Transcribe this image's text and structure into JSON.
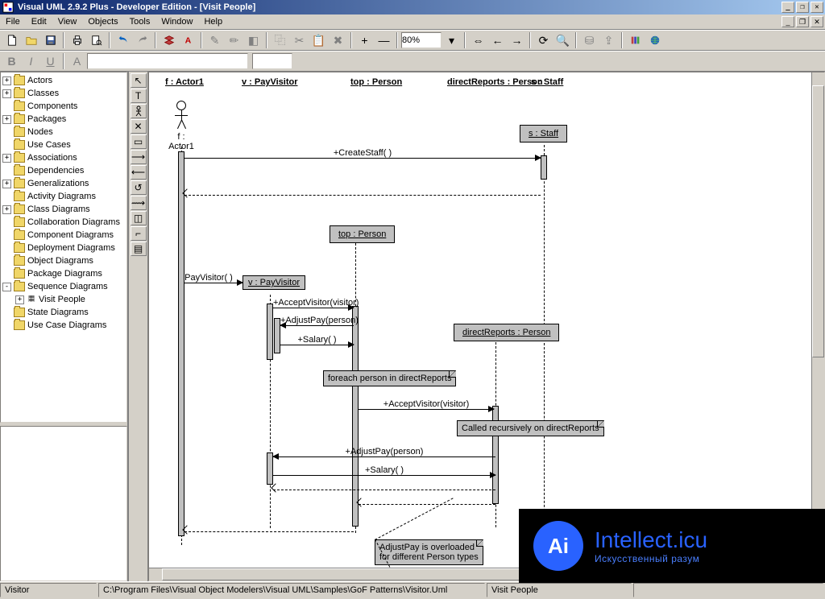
{
  "title": "Visual UML 2.9.2 Plus - Developer Edition - [Visit People]",
  "menu": [
    "File",
    "Edit",
    "View",
    "Objects",
    "Tools",
    "Window",
    "Help"
  ],
  "zoom": "80%",
  "tree": {
    "items": [
      {
        "toggle": "+",
        "label": "Actors"
      },
      {
        "toggle": "+",
        "label": "Classes"
      },
      {
        "toggle": "",
        "label": "Components"
      },
      {
        "toggle": "+",
        "label": "Packages"
      },
      {
        "toggle": "",
        "label": "Nodes"
      },
      {
        "toggle": "",
        "label": "Use Cases"
      },
      {
        "toggle": "+",
        "label": "Associations"
      },
      {
        "toggle": "",
        "label": "Dependencies"
      },
      {
        "toggle": "+",
        "label": "Generalizations"
      },
      {
        "toggle": "",
        "label": "Activity Diagrams"
      },
      {
        "toggle": "+",
        "label": "Class Diagrams"
      },
      {
        "toggle": "",
        "label": "Collaboration Diagrams"
      },
      {
        "toggle": "",
        "label": "Component Diagrams"
      },
      {
        "toggle": "",
        "label": "Deployment Diagrams"
      },
      {
        "toggle": "",
        "label": "Object Diagrams"
      },
      {
        "toggle": "",
        "label": "Package Diagrams"
      },
      {
        "toggle": "-",
        "label": "Sequence Diagrams"
      },
      {
        "toggle": "+",
        "indent": 1,
        "doc": true,
        "label": "Visit People"
      },
      {
        "toggle": "",
        "label": "State Diagrams"
      },
      {
        "toggle": "",
        "label": "Use Case Diagrams"
      }
    ]
  },
  "diagram": {
    "headers": [
      "f : Actor1",
      "v : PayVisitor",
      "top : Person",
      "directReports : Person",
      "s : Staff"
    ],
    "actor_label": "f : Actor1",
    "objects": {
      "staff": "s : Staff",
      "top": "top : Person",
      "pay": "v : PayVisitor",
      "direct": "directReports : Person"
    },
    "messages": {
      "create_staff": "+CreateStaff( )",
      "pay_visitor": "PayVisitor( )",
      "accept1": "+AcceptVisitor(visitor)",
      "adjust1": "+AdjustPay(person)",
      "salary1": "+Salary( )",
      "accept2": "+AcceptVisitor(visitor)",
      "adjust2": "+AdjustPay(person)",
      "salary2": "+Salary( )"
    },
    "notes": {
      "foreach": "foreach person in directReports",
      "recursive": "Called recursively on directReports",
      "overload": "AdjustPay is overloaded\nfor different Person types"
    }
  },
  "status": {
    "pane1": "Visitor",
    "pane2": "C:\\Program Files\\Visual Object Modelers\\Visual UML\\Samples\\GoF Patterns\\Visitor.Uml",
    "pane3": "Visit People"
  },
  "wm": {
    "brand": "Intellect.icu",
    "sub": "Искусственный разум",
    "logo": "Ai"
  }
}
